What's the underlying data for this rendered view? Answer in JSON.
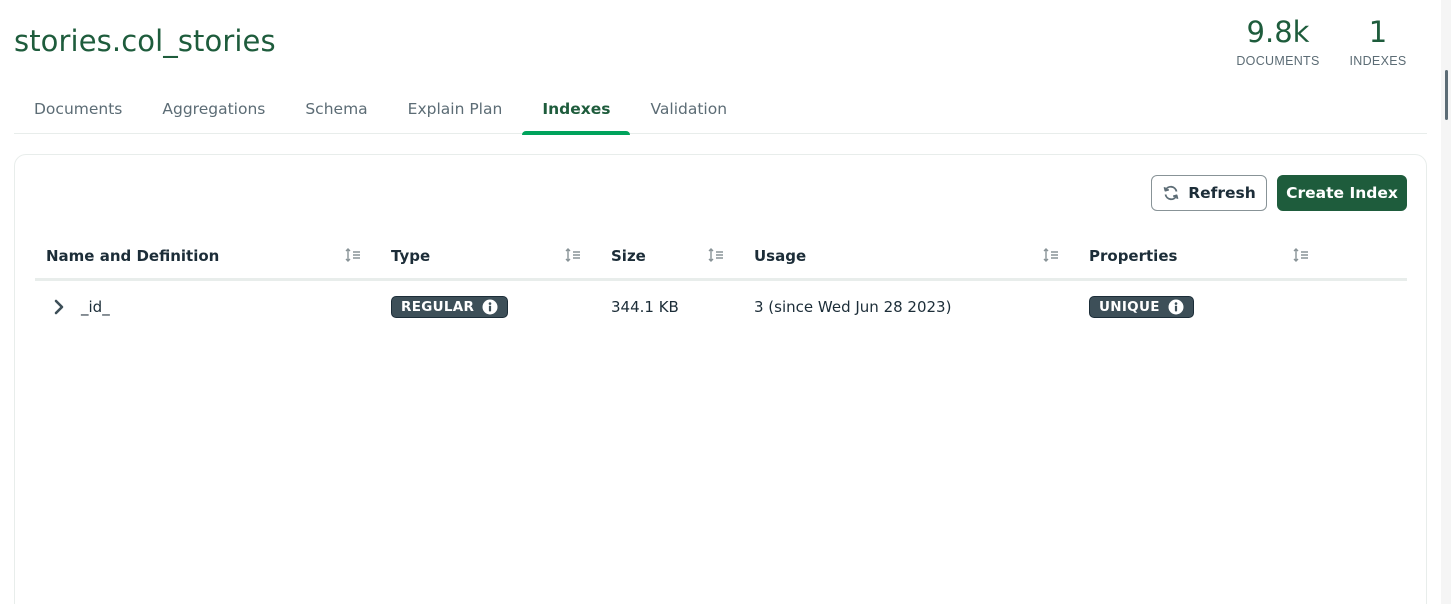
{
  "header": {
    "db_name": "stories",
    "separator": ".",
    "collection_name": "col_stories",
    "documents_count": "9.8k",
    "documents_label": "DOCUMENTS",
    "indexes_count": "1",
    "indexes_label": "INDEXES"
  },
  "tabs": [
    {
      "label": "Documents",
      "active": false
    },
    {
      "label": "Aggregations",
      "active": false
    },
    {
      "label": "Schema",
      "active": false
    },
    {
      "label": "Explain Plan",
      "active": false
    },
    {
      "label": "Indexes",
      "active": true
    },
    {
      "label": "Validation",
      "active": false
    }
  ],
  "toolbar": {
    "refresh_label": "Refresh",
    "create_label": "Create Index"
  },
  "table": {
    "columns": [
      "Name and Definition",
      "Type",
      "Size",
      "Usage",
      "Properties"
    ],
    "rows": [
      {
        "name": "_id_",
        "type": "REGULAR",
        "size": "344.1 KB",
        "usage": "3 (since Wed Jun 28 2023)",
        "properties": "UNIQUE"
      }
    ]
  },
  "colors": {
    "accent": "#1e5c3c",
    "active_tab_underline": "#00a35c",
    "badge_bg": "#3d4f58"
  },
  "icons": [
    "refresh-icon",
    "sort-icon",
    "chevron-right-icon",
    "info-icon"
  ]
}
